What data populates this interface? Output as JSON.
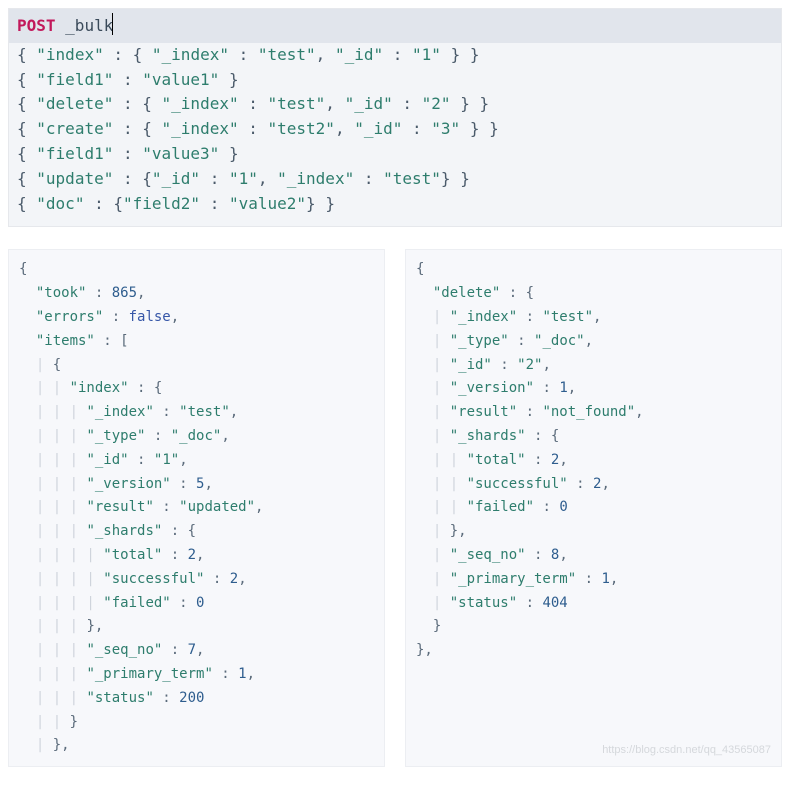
{
  "request": {
    "method": "POST",
    "endpoint": "_bulk",
    "body_lines_tokens": [
      [
        {
          "t": "{",
          "c": "brace"
        },
        {
          "t": " ",
          "c": "punc"
        },
        {
          "t": "\"index\"",
          "c": "key"
        },
        {
          "t": " : ",
          "c": "punc"
        },
        {
          "t": "{",
          "c": "brace"
        },
        {
          "t": " ",
          "c": "punc"
        },
        {
          "t": "\"_index\"",
          "c": "key"
        },
        {
          "t": " : ",
          "c": "punc"
        },
        {
          "t": "\"test\"",
          "c": "str"
        },
        {
          "t": ", ",
          "c": "punc"
        },
        {
          "t": "\"_id\"",
          "c": "key"
        },
        {
          "t": " : ",
          "c": "punc"
        },
        {
          "t": "\"1\"",
          "c": "str"
        },
        {
          "t": " ",
          "c": "punc"
        },
        {
          "t": "}",
          "c": "brace"
        },
        {
          "t": " ",
          "c": "punc"
        },
        {
          "t": "}",
          "c": "brace"
        }
      ],
      [
        {
          "t": "{",
          "c": "brace"
        },
        {
          "t": " ",
          "c": "punc"
        },
        {
          "t": "\"field1\"",
          "c": "key"
        },
        {
          "t": " : ",
          "c": "punc"
        },
        {
          "t": "\"value1\"",
          "c": "str"
        },
        {
          "t": " ",
          "c": "punc"
        },
        {
          "t": "}",
          "c": "brace"
        }
      ],
      [
        {
          "t": "{",
          "c": "brace"
        },
        {
          "t": " ",
          "c": "punc"
        },
        {
          "t": "\"delete\"",
          "c": "key"
        },
        {
          "t": " : ",
          "c": "punc"
        },
        {
          "t": "{",
          "c": "brace"
        },
        {
          "t": " ",
          "c": "punc"
        },
        {
          "t": "\"_index\"",
          "c": "key"
        },
        {
          "t": " : ",
          "c": "punc"
        },
        {
          "t": "\"test\"",
          "c": "str"
        },
        {
          "t": ", ",
          "c": "punc"
        },
        {
          "t": "\"_id\"",
          "c": "key"
        },
        {
          "t": " : ",
          "c": "punc"
        },
        {
          "t": "\"2\"",
          "c": "str"
        },
        {
          "t": " ",
          "c": "punc"
        },
        {
          "t": "}",
          "c": "brace"
        },
        {
          "t": " ",
          "c": "punc"
        },
        {
          "t": "}",
          "c": "brace"
        }
      ],
      [
        {
          "t": "{",
          "c": "brace"
        },
        {
          "t": " ",
          "c": "punc"
        },
        {
          "t": "\"create\"",
          "c": "key"
        },
        {
          "t": " : ",
          "c": "punc"
        },
        {
          "t": "{",
          "c": "brace"
        },
        {
          "t": " ",
          "c": "punc"
        },
        {
          "t": "\"_index\"",
          "c": "key"
        },
        {
          "t": " : ",
          "c": "punc"
        },
        {
          "t": "\"test2\"",
          "c": "str"
        },
        {
          "t": ", ",
          "c": "punc"
        },
        {
          "t": "\"_id\"",
          "c": "key"
        },
        {
          "t": " : ",
          "c": "punc"
        },
        {
          "t": "\"3\"",
          "c": "str"
        },
        {
          "t": " ",
          "c": "punc"
        },
        {
          "t": "}",
          "c": "brace"
        },
        {
          "t": " ",
          "c": "punc"
        },
        {
          "t": "}",
          "c": "brace"
        }
      ],
      [
        {
          "t": "{",
          "c": "brace"
        },
        {
          "t": " ",
          "c": "punc"
        },
        {
          "t": "\"field1\"",
          "c": "key"
        },
        {
          "t": " : ",
          "c": "punc"
        },
        {
          "t": "\"value3\"",
          "c": "str"
        },
        {
          "t": " ",
          "c": "punc"
        },
        {
          "t": "}",
          "c": "brace"
        }
      ],
      [
        {
          "t": "{",
          "c": "brace"
        },
        {
          "t": " ",
          "c": "punc"
        },
        {
          "t": "\"update\"",
          "c": "key"
        },
        {
          "t": " : ",
          "c": "punc"
        },
        {
          "t": "{",
          "c": "brace"
        },
        {
          "t": "\"_id\"",
          "c": "key"
        },
        {
          "t": " : ",
          "c": "punc"
        },
        {
          "t": "\"1\"",
          "c": "str"
        },
        {
          "t": ", ",
          "c": "punc"
        },
        {
          "t": "\"_index\"",
          "c": "key"
        },
        {
          "t": " : ",
          "c": "punc"
        },
        {
          "t": "\"test\"",
          "c": "str"
        },
        {
          "t": "}",
          "c": "brace"
        },
        {
          "t": " ",
          "c": "punc"
        },
        {
          "t": "}",
          "c": "brace"
        }
      ],
      [
        {
          "t": "{",
          "c": "brace"
        },
        {
          "t": " ",
          "c": "punc"
        },
        {
          "t": "\"doc\"",
          "c": "key"
        },
        {
          "t": " : ",
          "c": "punc"
        },
        {
          "t": "{",
          "c": "brace"
        },
        {
          "t": "\"field2\"",
          "c": "key"
        },
        {
          "t": " : ",
          "c": "punc"
        },
        {
          "t": "\"value2\"",
          "c": "str"
        },
        {
          "t": "}",
          "c": "brace"
        },
        {
          "t": " ",
          "c": "punc"
        },
        {
          "t": "}",
          "c": "brace"
        }
      ]
    ]
  },
  "result_left_tokens": [
    [
      {
        "t": "{",
        "c": "punc"
      }
    ],
    [
      {
        "t": "  ",
        "c": "punc"
      },
      {
        "t": "\"took\"",
        "c": "key"
      },
      {
        "t": " : ",
        "c": "punc"
      },
      {
        "t": "865",
        "c": "num"
      },
      {
        "t": ",",
        "c": "punc"
      }
    ],
    [
      {
        "t": "  ",
        "c": "punc"
      },
      {
        "t": "\"errors\"",
        "c": "key"
      },
      {
        "t": " : ",
        "c": "punc"
      },
      {
        "t": "false",
        "c": "bool"
      },
      {
        "t": ",",
        "c": "punc"
      }
    ],
    [
      {
        "t": "  ",
        "c": "punc"
      },
      {
        "t": "\"items\"",
        "c": "key"
      },
      {
        "t": " : [",
        "c": "punc"
      }
    ],
    [
      {
        "t": "  ",
        "c": "punc"
      },
      {
        "t": "| ",
        "c": "guide"
      },
      {
        "t": "{",
        "c": "punc"
      }
    ],
    [
      {
        "t": "  ",
        "c": "punc"
      },
      {
        "t": "| | ",
        "c": "guide"
      },
      {
        "t": "\"index\"",
        "c": "key"
      },
      {
        "t": " : {",
        "c": "punc"
      }
    ],
    [
      {
        "t": "  ",
        "c": "punc"
      },
      {
        "t": "| | | ",
        "c": "guide"
      },
      {
        "t": "\"_index\"",
        "c": "key"
      },
      {
        "t": " : ",
        "c": "punc"
      },
      {
        "t": "\"test\"",
        "c": "str"
      },
      {
        "t": ",",
        "c": "punc"
      }
    ],
    [
      {
        "t": "  ",
        "c": "punc"
      },
      {
        "t": "| | | ",
        "c": "guide"
      },
      {
        "t": "\"_type\"",
        "c": "key"
      },
      {
        "t": " : ",
        "c": "punc"
      },
      {
        "t": "\"_doc\"",
        "c": "str"
      },
      {
        "t": ",",
        "c": "punc"
      }
    ],
    [
      {
        "t": "  ",
        "c": "punc"
      },
      {
        "t": "| | | ",
        "c": "guide"
      },
      {
        "t": "\"_id\"",
        "c": "key"
      },
      {
        "t": " : ",
        "c": "punc"
      },
      {
        "t": "\"1\"",
        "c": "str"
      },
      {
        "t": ",",
        "c": "punc"
      }
    ],
    [
      {
        "t": "  ",
        "c": "punc"
      },
      {
        "t": "| | | ",
        "c": "guide"
      },
      {
        "t": "\"_version\"",
        "c": "key"
      },
      {
        "t": " : ",
        "c": "punc"
      },
      {
        "t": "5",
        "c": "num"
      },
      {
        "t": ",",
        "c": "punc"
      }
    ],
    [
      {
        "t": "  ",
        "c": "punc"
      },
      {
        "t": "| | | ",
        "c": "guide"
      },
      {
        "t": "\"result\"",
        "c": "key"
      },
      {
        "t": " : ",
        "c": "punc"
      },
      {
        "t": "\"updated\"",
        "c": "str"
      },
      {
        "t": ",",
        "c": "punc"
      }
    ],
    [
      {
        "t": "  ",
        "c": "punc"
      },
      {
        "t": "| | | ",
        "c": "guide"
      },
      {
        "t": "\"_shards\"",
        "c": "key"
      },
      {
        "t": " : {",
        "c": "punc"
      }
    ],
    [
      {
        "t": "  ",
        "c": "punc"
      },
      {
        "t": "| | | | ",
        "c": "guide"
      },
      {
        "t": "\"total\"",
        "c": "key"
      },
      {
        "t": " : ",
        "c": "punc"
      },
      {
        "t": "2",
        "c": "num"
      },
      {
        "t": ",",
        "c": "punc"
      }
    ],
    [
      {
        "t": "  ",
        "c": "punc"
      },
      {
        "t": "| | | | ",
        "c": "guide"
      },
      {
        "t": "\"successful\"",
        "c": "key"
      },
      {
        "t": " : ",
        "c": "punc"
      },
      {
        "t": "2",
        "c": "num"
      },
      {
        "t": ",",
        "c": "punc"
      }
    ],
    [
      {
        "t": "  ",
        "c": "punc"
      },
      {
        "t": "| | | | ",
        "c": "guide"
      },
      {
        "t": "\"failed\"",
        "c": "key"
      },
      {
        "t": " : ",
        "c": "punc"
      },
      {
        "t": "0",
        "c": "num"
      }
    ],
    [
      {
        "t": "  ",
        "c": "punc"
      },
      {
        "t": "| | | ",
        "c": "guide"
      },
      {
        "t": "},",
        "c": "punc"
      }
    ],
    [
      {
        "t": "  ",
        "c": "punc"
      },
      {
        "t": "| | | ",
        "c": "guide"
      },
      {
        "t": "\"_seq_no\"",
        "c": "key"
      },
      {
        "t": " : ",
        "c": "punc"
      },
      {
        "t": "7",
        "c": "num"
      },
      {
        "t": ",",
        "c": "punc"
      }
    ],
    [
      {
        "t": "  ",
        "c": "punc"
      },
      {
        "t": "| | | ",
        "c": "guide"
      },
      {
        "t": "\"_primary_term\"",
        "c": "key"
      },
      {
        "t": " : ",
        "c": "punc"
      },
      {
        "t": "1",
        "c": "num"
      },
      {
        "t": ",",
        "c": "punc"
      }
    ],
    [
      {
        "t": "  ",
        "c": "punc"
      },
      {
        "t": "| | | ",
        "c": "guide"
      },
      {
        "t": "\"status\"",
        "c": "key"
      },
      {
        "t": " : ",
        "c": "punc"
      },
      {
        "t": "200",
        "c": "num"
      }
    ],
    [
      {
        "t": "  ",
        "c": "punc"
      },
      {
        "t": "| | ",
        "c": "guide"
      },
      {
        "t": "}",
        "c": "punc"
      }
    ],
    [
      {
        "t": "  ",
        "c": "punc"
      },
      {
        "t": "| ",
        "c": "guide"
      },
      {
        "t": "},",
        "c": "punc"
      }
    ]
  ],
  "result_right_tokens": [
    [
      {
        "t": "{",
        "c": "punc"
      }
    ],
    [
      {
        "t": "  ",
        "c": "punc"
      },
      {
        "t": "\"delete\"",
        "c": "key"
      },
      {
        "t": " : {",
        "c": "punc"
      }
    ],
    [
      {
        "t": "  ",
        "c": "punc"
      },
      {
        "t": "| ",
        "c": "guide"
      },
      {
        "t": "\"_index\"",
        "c": "key"
      },
      {
        "t": " : ",
        "c": "punc"
      },
      {
        "t": "\"test\"",
        "c": "str"
      },
      {
        "t": ",",
        "c": "punc"
      }
    ],
    [
      {
        "t": "  ",
        "c": "punc"
      },
      {
        "t": "| ",
        "c": "guide"
      },
      {
        "t": "\"_type\"",
        "c": "key"
      },
      {
        "t": " : ",
        "c": "punc"
      },
      {
        "t": "\"_doc\"",
        "c": "str"
      },
      {
        "t": ",",
        "c": "punc"
      }
    ],
    [
      {
        "t": "  ",
        "c": "punc"
      },
      {
        "t": "| ",
        "c": "guide"
      },
      {
        "t": "\"_id\"",
        "c": "key"
      },
      {
        "t": " : ",
        "c": "punc"
      },
      {
        "t": "\"2\"",
        "c": "str"
      },
      {
        "t": ",",
        "c": "punc"
      }
    ],
    [
      {
        "t": "  ",
        "c": "punc"
      },
      {
        "t": "| ",
        "c": "guide"
      },
      {
        "t": "\"_version\"",
        "c": "key"
      },
      {
        "t": " : ",
        "c": "punc"
      },
      {
        "t": "1",
        "c": "num"
      },
      {
        "t": ",",
        "c": "punc"
      }
    ],
    [
      {
        "t": "  ",
        "c": "punc"
      },
      {
        "t": "| ",
        "c": "guide"
      },
      {
        "t": "\"result\"",
        "c": "key"
      },
      {
        "t": " : ",
        "c": "punc"
      },
      {
        "t": "\"not_found\"",
        "c": "str"
      },
      {
        "t": ",",
        "c": "punc"
      }
    ],
    [
      {
        "t": "  ",
        "c": "punc"
      },
      {
        "t": "| ",
        "c": "guide"
      },
      {
        "t": "\"_shards\"",
        "c": "key"
      },
      {
        "t": " : {",
        "c": "punc"
      }
    ],
    [
      {
        "t": "  ",
        "c": "punc"
      },
      {
        "t": "| | ",
        "c": "guide"
      },
      {
        "t": "\"total\"",
        "c": "key"
      },
      {
        "t": " : ",
        "c": "punc"
      },
      {
        "t": "2",
        "c": "num"
      },
      {
        "t": ",",
        "c": "punc"
      }
    ],
    [
      {
        "t": "  ",
        "c": "punc"
      },
      {
        "t": "| | ",
        "c": "guide"
      },
      {
        "t": "\"successful\"",
        "c": "key"
      },
      {
        "t": " : ",
        "c": "punc"
      },
      {
        "t": "2",
        "c": "num"
      },
      {
        "t": ",",
        "c": "punc"
      }
    ],
    [
      {
        "t": "  ",
        "c": "punc"
      },
      {
        "t": "| | ",
        "c": "guide"
      },
      {
        "t": "\"failed\"",
        "c": "key"
      },
      {
        "t": " : ",
        "c": "punc"
      },
      {
        "t": "0",
        "c": "num"
      }
    ],
    [
      {
        "t": "  ",
        "c": "punc"
      },
      {
        "t": "| ",
        "c": "guide"
      },
      {
        "t": "},",
        "c": "punc"
      }
    ],
    [
      {
        "t": "  ",
        "c": "punc"
      },
      {
        "t": "| ",
        "c": "guide"
      },
      {
        "t": "\"_seq_no\"",
        "c": "key"
      },
      {
        "t": " : ",
        "c": "punc"
      },
      {
        "t": "8",
        "c": "num"
      },
      {
        "t": ",",
        "c": "punc"
      }
    ],
    [
      {
        "t": "  ",
        "c": "punc"
      },
      {
        "t": "| ",
        "c": "guide"
      },
      {
        "t": "\"_primary_term\"",
        "c": "key"
      },
      {
        "t": " : ",
        "c": "punc"
      },
      {
        "t": "1",
        "c": "num"
      },
      {
        "t": ",",
        "c": "punc"
      }
    ],
    [
      {
        "t": "  ",
        "c": "punc"
      },
      {
        "t": "| ",
        "c": "guide"
      },
      {
        "t": "\"status\"",
        "c": "key"
      },
      {
        "t": " : ",
        "c": "punc"
      },
      {
        "t": "404",
        "c": "num"
      }
    ],
    [
      {
        "t": "  ",
        "c": "punc"
      },
      {
        "t": "}",
        "c": "punc"
      }
    ],
    [
      {
        "t": "},",
        "c": "punc"
      }
    ]
  ],
  "watermark": "https://blog.csdn.net/qq_43565087"
}
